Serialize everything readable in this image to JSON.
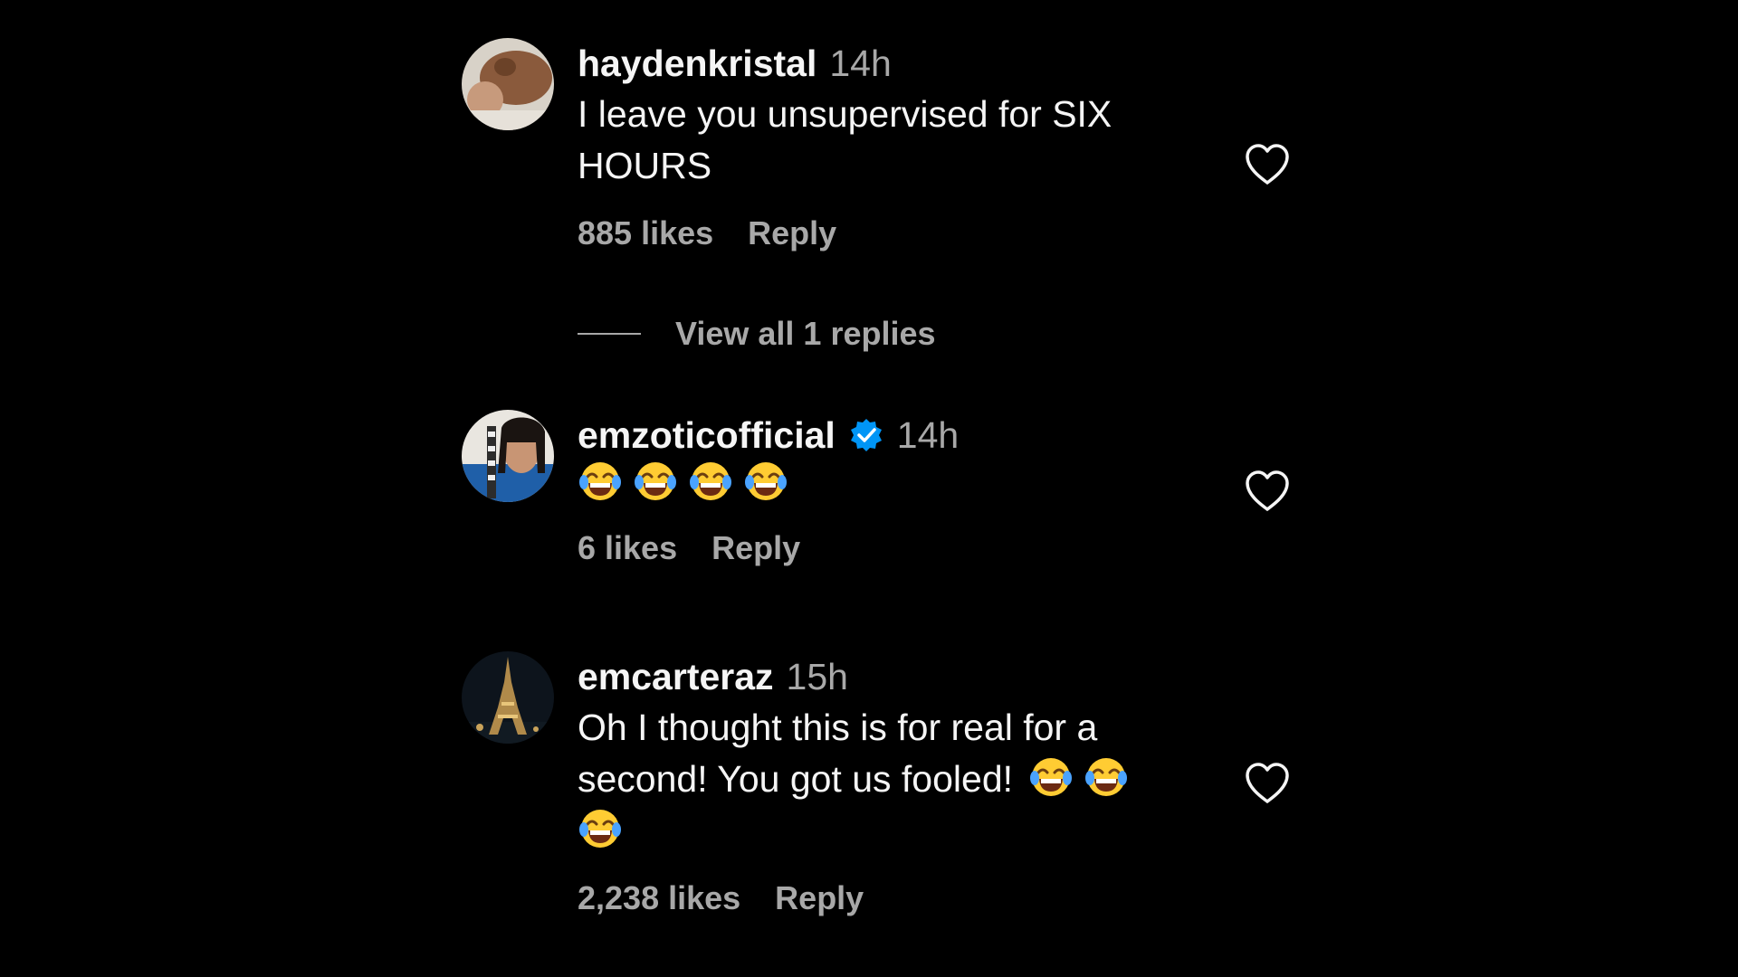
{
  "comments": [
    {
      "username": "haydenkristal",
      "time": "14h",
      "text_lines": [
        "I leave you unsupervised for SIX",
        "HOURS"
      ],
      "likes": "885 likes",
      "reply_label": "Reply",
      "verified": false
    },
    {
      "username": "emzoticofficial",
      "time": "14h",
      "emojis": [
        "face-with-tears-of-joy",
        "face-with-tears-of-joy",
        "face-with-tears-of-joy",
        "face-with-tears-of-joy"
      ],
      "likes": "6 likes",
      "reply_label": "Reply",
      "verified": true
    },
    {
      "username": "emcarteraz",
      "time": "15h",
      "text_lines": [
        "Oh I thought this is for real for a",
        "second! You got us fooled!"
      ],
      "trailing_emojis": [
        "face-with-tears-of-joy",
        "face-with-tears-of-joy",
        "face-with-tears-of-joy"
      ],
      "likes": "2,238 likes",
      "reply_label": "Reply",
      "verified": false
    }
  ],
  "view_replies": {
    "label": "View all 1 replies"
  },
  "icons": {
    "like": "heart-outline-icon",
    "verified": "verified-badge-icon",
    "emoji": "face-with-tears-of-joy"
  },
  "colors": {
    "background": "#000000",
    "primary_text": "#f5f5f5",
    "secondary_text": "#a8a8a8",
    "verified_blue": "#0095f6"
  }
}
